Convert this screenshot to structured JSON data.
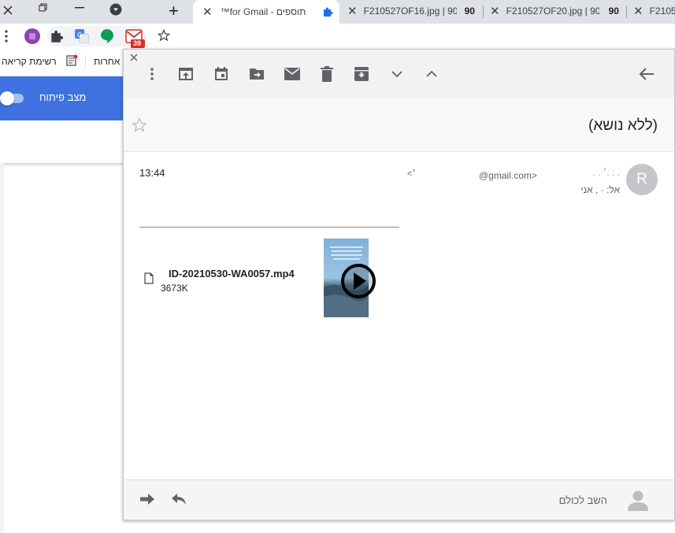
{
  "browser": {
    "tabs": [
      {
        "title": "תוספים - for Gmail™",
        "active": true,
        "icon": "puzzle-icon"
      },
      {
        "title": "F210527OF16.jpg | 90",
        "count": "90"
      },
      {
        "title": "F210527OF20.jpg | 90",
        "count": "90"
      },
      {
        "title": "F2105"
      }
    ],
    "new_tab_symbol": "+",
    "gmail_badge": "39"
  },
  "bookmarks": {
    "reading_list": "רשימת קריאה",
    "others": "אחרות"
  },
  "popup": {
    "dev_mode_label": "מצב פיתוח"
  },
  "email": {
    "subject": "(ללא נושא)",
    "sender_initial": "R",
    "sender_email": "@gmail.com>",
    "sender_name": ". . ׳. : .",
    "recipient_line": "אל: ·   ,  אני",
    "chevron": "<׳",
    "time": "13:44",
    "attachment": {
      "filename": "ID-20210530-WA0057.mp4",
      "size": "3673K"
    },
    "reply_all": "השב לכולם"
  },
  "colors": {
    "accent_blue": "#3f72e0",
    "tab_bar": "#dee1e6",
    "gmail_red": "#d93025"
  }
}
